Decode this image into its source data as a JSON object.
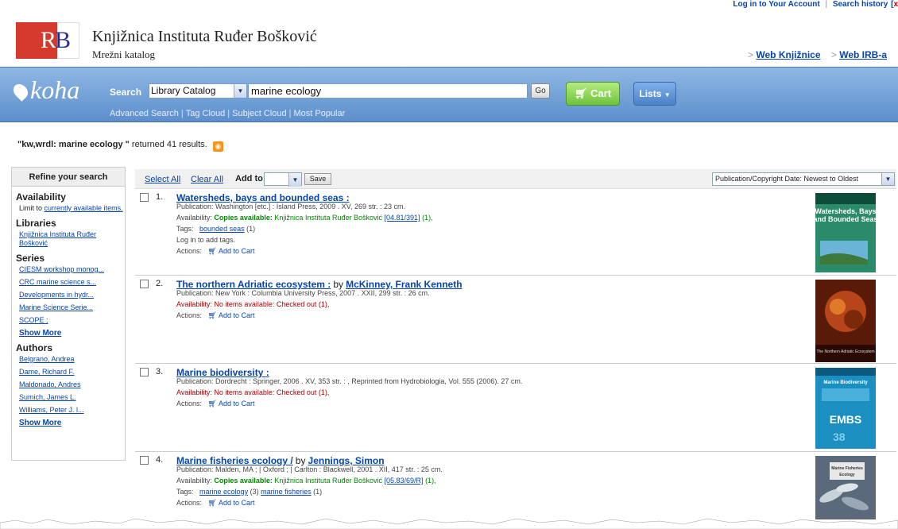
{
  "top": {
    "login": "Log in to Your Account",
    "history": "Search history",
    "close": "x"
  },
  "header": {
    "logo": {
      "r": "R",
      "b": "B"
    },
    "library_name": "Knjižnica Instituta Ruđer Bošković",
    "subtitle": "Mrežni katalog",
    "links": [
      "Web Knjižnice",
      "Web IRB-a"
    ]
  },
  "search": {
    "brand": "koha",
    "label": "Search",
    "catalog": "Library Catalog",
    "query": "marine ecology",
    "go": "Go",
    "cart": "Cart",
    "lists": "Lists",
    "sublinks": [
      "Advanced Search",
      "Tag Cloud",
      "Subject Cloud",
      "Most Popular"
    ]
  },
  "results_summary": {
    "query": "\"kw,wrdl: marine ecology \"",
    "text": "returned 41 results."
  },
  "facets": {
    "header": "Refine your search",
    "availability": {
      "title": "Availability",
      "prefix": "Limit to",
      "link": "currently available items."
    },
    "libraries": {
      "title": "Libraries",
      "items": [
        "Knjižnica Instituta Ruđer Bošković"
      ]
    },
    "series": {
      "title": "Series",
      "items": [
        "CIESM workshop monog...",
        "CRC marine science s...",
        "Developments in hydr...",
        "Marine Science Serie...",
        "SCOPE ;"
      ],
      "more": "Show More"
    },
    "authors": {
      "title": "Authors",
      "items": [
        "Belgrano, Andrea",
        "Dame, Richard F.",
        "Maldonado, Andres",
        "Sumich, James L.",
        "Williams, Peter J. l..."
      ],
      "more": "Show More"
    }
  },
  "toolbar": {
    "select_all": "Select All",
    "clear_all": "Clear All",
    "add_to": "Add to:",
    "save": "Save",
    "sort": "Publication/Copyright Date: Newest to Oldest"
  },
  "results": [
    {
      "num": "1.",
      "title": "Watersheds, bays and bounded seas :",
      "by": "",
      "author": "",
      "publication": "Publication: Washington [etc.] : Island Press, 2009 . XV, 269 str. : 23 cm.",
      "availability_label": "Availability:",
      "availability_status": "Copies available:",
      "availability_text": "Knjižnica Instituta Ruđer Bošković",
      "callnumber": "[04.81/391]",
      "count": "(1),",
      "tags_label": "Tags:",
      "tags": "bounded seas",
      "tags_rest": "(1)",
      "login_tags": "Log in to add tags.",
      "actions": "Actions:",
      "add_cart": "Add to Cart"
    },
    {
      "num": "2.",
      "title": "The northern Adriatic ecosystem :",
      "by": "by",
      "author": "McKinney, Frank Kenneth",
      "publication": "Publication: New York : Columbia University Press, 2007 . XXII, 299 str. : 26 cm.",
      "availability": "Availability: No items available: Checked out (1),",
      "actions": "Actions:",
      "add_cart": "Add to Cart"
    },
    {
      "num": "3.",
      "title": "Marine biodiversity :",
      "publication": "Publication: Dordrecht : Springer, 2006 . XV, 353 str. : , Reprinted from Hydrobiologia, Vol. 555 (2006). 27 cm.",
      "availability": "Availability: No items available: Checked out (1),",
      "actions": "Actions:",
      "add_cart": "Add to Cart"
    },
    {
      "num": "4.",
      "title": "Marine fisheries ecology /",
      "by": "by",
      "author": "Jennings, Simon",
      "publication": "Publication: Malden, MA ; | Oxford ; | Carlton : Blackwell, 2001 . XII, 417 str. : 25 cm.",
      "availability_label": "Availability:",
      "availability_status": "Copies available:",
      "availability_text": "Knjižnica Instituta Ruđer Bošković",
      "callnumber": "[05.83/69/R]",
      "count": "(1),",
      "tags_label": "Tags:",
      "tag1": "marine ecology",
      "tag1_count": "(3)",
      "tag2": "marine fisheries",
      "tag2_count": "(1)",
      "actions": "Actions:",
      "add_cart": "Add to Cart"
    }
  ],
  "covers": [
    {
      "top_text": "Watersheds, Bays and Bounded Seas",
      "color": "#2a8a6a"
    },
    {
      "top_text": "",
      "bottom_text": "The Northern Adriatic Ecosystem",
      "color": "#8a2a10"
    },
    {
      "top_text": "Marine Biodiversity",
      "bottom_text": "EMBS",
      "color": "#1a8fc0"
    },
    {
      "top_text": "Marine Fisheries Ecology",
      "color": "#5a6a7a"
    }
  ]
}
